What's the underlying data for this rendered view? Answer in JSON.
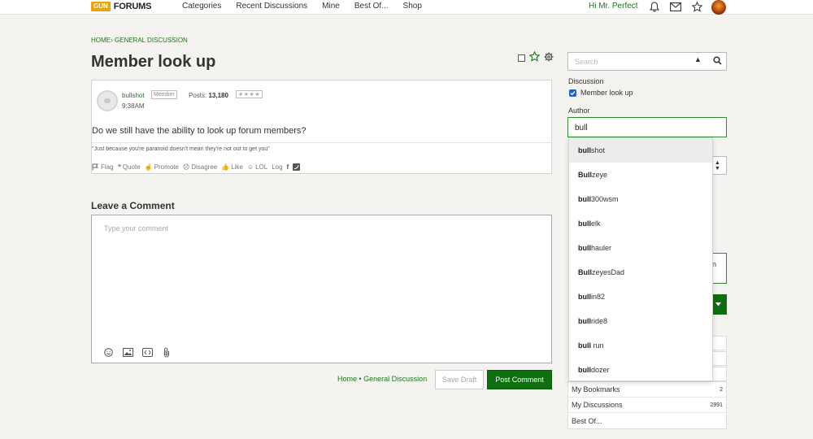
{
  "header": {
    "logo_badge": "GUN",
    "logo_text": "FORUMS",
    "nav": [
      "Categories",
      "Recent Discussions",
      "Mine",
      "Best Of...",
      "Shop"
    ],
    "greeting": "Hi Mr. Perfect"
  },
  "breadcrumb": "HOME› GENERAL DISCUSSION",
  "page_title": "Member look up",
  "post": {
    "author": "bullshot",
    "badge": "Member",
    "posts_label": "Posts:",
    "posts_count": "13,180",
    "stars": "★★★★",
    "time": "9:38AM",
    "body": "Do we still have the ability to look up forum members?",
    "signature": "\"Just because you're paranoid doesn't mean they're not out to get you\"",
    "actions": [
      "Flag",
      "Quote",
      "Promote",
      "Disagree",
      "Like",
      "LOL",
      "Log"
    ]
  },
  "comment": {
    "heading": "Leave a Comment",
    "placeholder": "Type your comment",
    "footer_breadcrumb": "Home • General Discussion",
    "save_draft": "Save Draft",
    "post_comment": "Post Comment"
  },
  "sidebar": {
    "search_placeholder": "Search",
    "discussion_label": "Discussion",
    "discussion_checkbox": "Member look up",
    "author_label": "Author",
    "author_value": "bull",
    "partial_text": "n",
    "links": [
      {
        "label": "My Bookmarks",
        "count": "2"
      },
      {
        "label": "My Discussions",
        "count": "2991"
      },
      {
        "label": "Best Of...",
        "count": ""
      }
    ]
  },
  "autocomplete": {
    "query": "bull",
    "items": [
      {
        "match": "bull",
        "rest": "shot"
      },
      {
        "match": "Bull",
        "rest": "zeye"
      },
      {
        "match": "bull",
        "rest": "300wsm"
      },
      {
        "match": "bull",
        "rest": "elk"
      },
      {
        "match": "bull",
        "rest": "hauler"
      },
      {
        "match": "Bull",
        "rest": "zeyesDad"
      },
      {
        "match": "bull",
        "rest": "in82"
      },
      {
        "match": "bull",
        "rest": "ride8"
      },
      {
        "match": "bull",
        "rest": " run"
      },
      {
        "match": "bull",
        "rest": "dozer"
      }
    ]
  },
  "colors": {
    "brand_green": "#0f6e0f",
    "link_green": "#1a7a1a",
    "logo_orange": "#e8a40c"
  }
}
